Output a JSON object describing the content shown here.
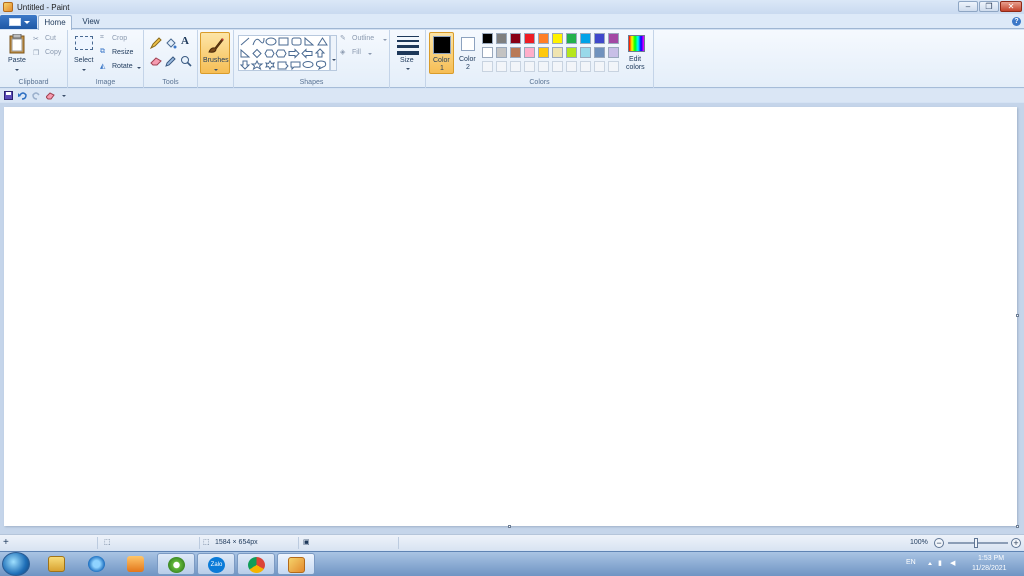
{
  "window": {
    "title": "Untitled - Paint"
  },
  "tabs": [
    "Home",
    "View"
  ],
  "ribbon": {
    "clipboard": {
      "paste": "Paste",
      "cut": "Cut",
      "copy": "Copy",
      "label": "Clipboard"
    },
    "image": {
      "select": "Select",
      "crop": "Crop",
      "resize": "Resize",
      "rotate": "Rotate",
      "label": "Image"
    },
    "tools": {
      "label": "Tools"
    },
    "brushes": {
      "label": "Brushes"
    },
    "shapes": {
      "outline": "Outline",
      "fill": "Fill",
      "label": "Shapes"
    },
    "size": {
      "label": "Size"
    },
    "colors": {
      "color1_line1": "Color",
      "color1_line2": "1",
      "color2_line1": "Color",
      "color2_line2": "2",
      "edit_line1": "Edit",
      "edit_line2": "colors",
      "label": "Colors",
      "color1": "#000000",
      "color2": "#ffffff",
      "palette_row1": [
        "#000000",
        "#7f7f7f",
        "#880015",
        "#ed1c24",
        "#ff7f27",
        "#fff200",
        "#22b14c",
        "#00a2e8",
        "#3f48cc",
        "#a349a4"
      ],
      "palette_row2": [
        "#ffffff",
        "#c3c3c3",
        "#b97a57",
        "#ffaec9",
        "#ffc90e",
        "#efe4b0",
        "#b5e61d",
        "#99d9ea",
        "#7092be",
        "#c8bfe7"
      ]
    }
  },
  "status": {
    "dimensions": "1584 × 654px",
    "zoom": "100%"
  },
  "taskbar": {
    "zalo": "Zalo",
    "language": "EN",
    "time": "1:53 PM",
    "date": "11/28/2021"
  }
}
